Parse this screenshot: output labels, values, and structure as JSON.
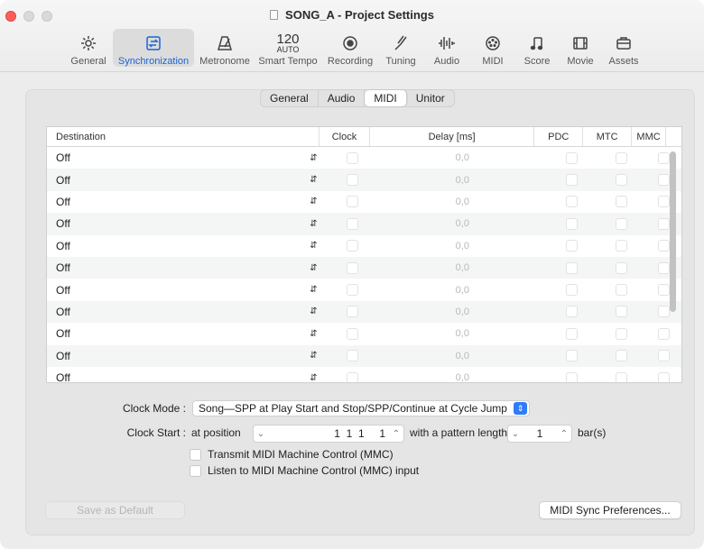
{
  "window": {
    "title": "SONG_A - Project Settings"
  },
  "toolbar": {
    "items": [
      {
        "label": "General",
        "icon": "gear-icon"
      },
      {
        "label": "Synchronization",
        "icon": "sync-icon",
        "active": true
      },
      {
        "label": "Metronome",
        "icon": "metronome-icon"
      },
      {
        "label": "Smart Tempo",
        "tempo_value": "120",
        "tempo_mode": "AUTO"
      },
      {
        "label": "Recording",
        "icon": "record-icon"
      },
      {
        "label": "Tuning",
        "icon": "tuning-fork-icon"
      },
      {
        "label": "Audio",
        "icon": "waveform-icon"
      },
      {
        "label": "MIDI",
        "icon": "midi-port-icon"
      },
      {
        "label": "Score",
        "icon": "notes-icon"
      },
      {
        "label": "Movie",
        "icon": "film-icon"
      },
      {
        "label": "Assets",
        "icon": "briefcase-icon"
      }
    ]
  },
  "tabs": [
    "General",
    "Audio",
    "MIDI",
    "Unitor"
  ],
  "active_tab": "MIDI",
  "table": {
    "headers": {
      "destination": "Destination",
      "clock": "Clock",
      "delay": "Delay [ms]",
      "pdc": "PDC",
      "mtc": "MTC",
      "mmc": "MMC"
    },
    "rows": [
      {
        "destination": "Off",
        "delay": "0,0"
      },
      {
        "destination": "Off",
        "delay": "0,0"
      },
      {
        "destination": "Off",
        "delay": "0,0"
      },
      {
        "destination": "Off",
        "delay": "0,0"
      },
      {
        "destination": "Off",
        "delay": "0,0"
      },
      {
        "destination": "Off",
        "delay": "0,0"
      },
      {
        "destination": "Off",
        "delay": "0,0"
      },
      {
        "destination": "Off",
        "delay": "0,0"
      },
      {
        "destination": "Off",
        "delay": "0,0"
      },
      {
        "destination": "Off",
        "delay": "0,0"
      },
      {
        "destination": "Off",
        "delay": "0,0"
      }
    ]
  },
  "clock_mode": {
    "label": "Clock Mode :",
    "value": "Song—SPP at Play Start and Stop/SPP/Continue at Cycle Jump"
  },
  "clock_start": {
    "label": "Clock Start :",
    "prefix": "at position",
    "position": "1  1  1     1",
    "middle": "with a pattern length of",
    "pattern_length": "1",
    "suffix": "bar(s)"
  },
  "checkboxes": {
    "transmit_mmc": "Transmit MIDI Machine Control (MMC)",
    "listen_mmc": "Listen to MIDI Machine Control (MMC) input"
  },
  "buttons": {
    "save_default": "Save as Default",
    "midi_sync_prefs": "MIDI Sync Preferences..."
  },
  "colors": {
    "accent": "#1a64d6",
    "close": "#ff5f57",
    "select_blue": "#2f7cf6"
  }
}
